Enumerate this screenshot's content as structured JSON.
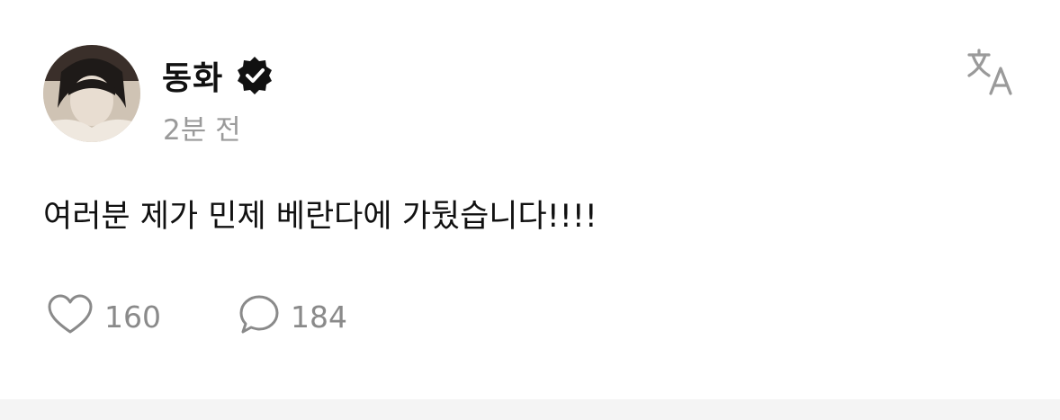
{
  "post": {
    "author": {
      "name": "동화",
      "verified": true,
      "avatar_icon": "avatar-photo"
    },
    "timestamp": "2분 전",
    "text": "여러분 제가 민제 베란다에 가뒀습니다!!!!",
    "actions": {
      "likes": {
        "icon": "heart-icon",
        "count": "160"
      },
      "comments": {
        "icon": "comment-bubble-icon",
        "count": "184"
      }
    },
    "translate_icon": "translate-icon"
  },
  "colors": {
    "text": "#111111",
    "muted": "#9a9a9a",
    "icon": "#8a8a8a",
    "verified_badge": "#111111",
    "background": "#ffffff"
  }
}
